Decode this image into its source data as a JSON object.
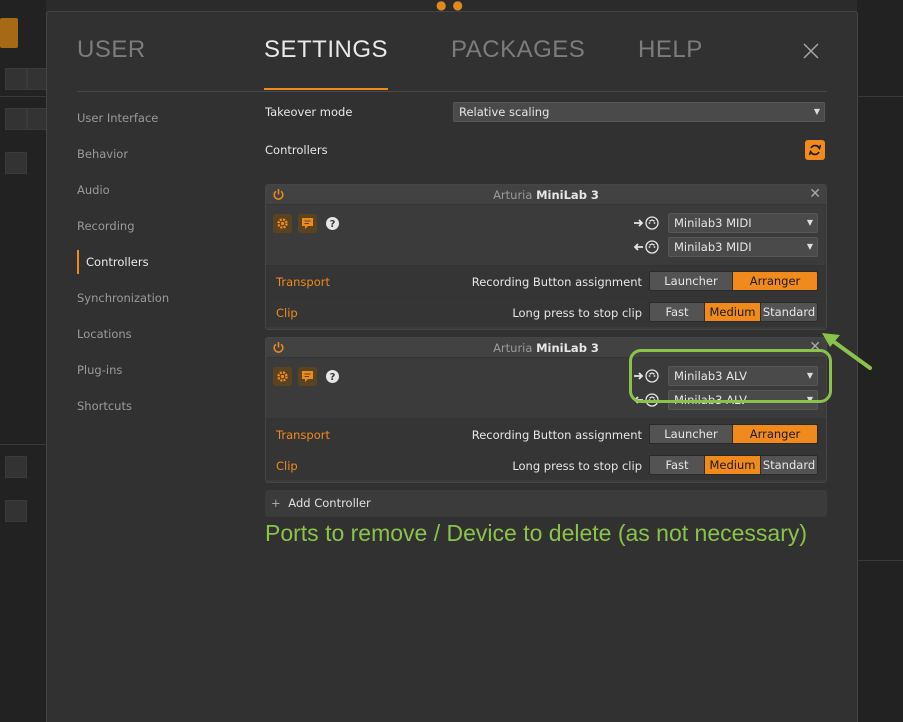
{
  "tabs": [
    {
      "label": "USER"
    },
    {
      "label": "SETTINGS"
    },
    {
      "label": "PACKAGES"
    },
    {
      "label": "HELP"
    }
  ],
  "sidebar": {
    "items": [
      {
        "label": "User Interface"
      },
      {
        "label": "Behavior"
      },
      {
        "label": "Audio"
      },
      {
        "label": "Recording"
      },
      {
        "label": "Controllers"
      },
      {
        "label": "Synchronization"
      },
      {
        "label": "Locations"
      },
      {
        "label": "Plug-ins"
      },
      {
        "label": "Shortcuts"
      }
    ],
    "active": "Controllers"
  },
  "settings": {
    "takeover_label": "Takeover mode",
    "takeover_value": "Relative scaling",
    "controllers_label": "Controllers"
  },
  "controllers": [
    {
      "vendor": "Arturia",
      "model": "MiniLab 3",
      "input_port": "Minilab3 MIDI",
      "output_port": "Minilab3 MIDI",
      "transport": {
        "name": "Transport",
        "label": "Recording Button assignment",
        "options": [
          "Launcher",
          "Arranger"
        ],
        "selected": "Arranger"
      },
      "clip": {
        "name": "Clip",
        "label": "Long press to stop clip",
        "options": [
          "Fast",
          "Medium",
          "Standard"
        ],
        "selected": "Medium"
      }
    },
    {
      "vendor": "Arturia",
      "model": "MiniLab 3",
      "input_port": "Minilab3 ALV",
      "output_port": "Minilab3 ALV",
      "transport": {
        "name": "Transport",
        "label": "Recording Button assignment",
        "options": [
          "Launcher",
          "Arranger"
        ],
        "selected": "Arranger"
      },
      "clip": {
        "name": "Clip",
        "label": "Long press to stop clip",
        "options": [
          "Fast",
          "Medium",
          "Standard"
        ],
        "selected": "Medium"
      }
    }
  ],
  "add_controller_label": "Add Controller",
  "annotation": "Ports to remove / Device to delete (as not necessary)",
  "colors": {
    "accent": "#f08a1c",
    "annotation": "#8bc34a",
    "panel": "#313131"
  }
}
